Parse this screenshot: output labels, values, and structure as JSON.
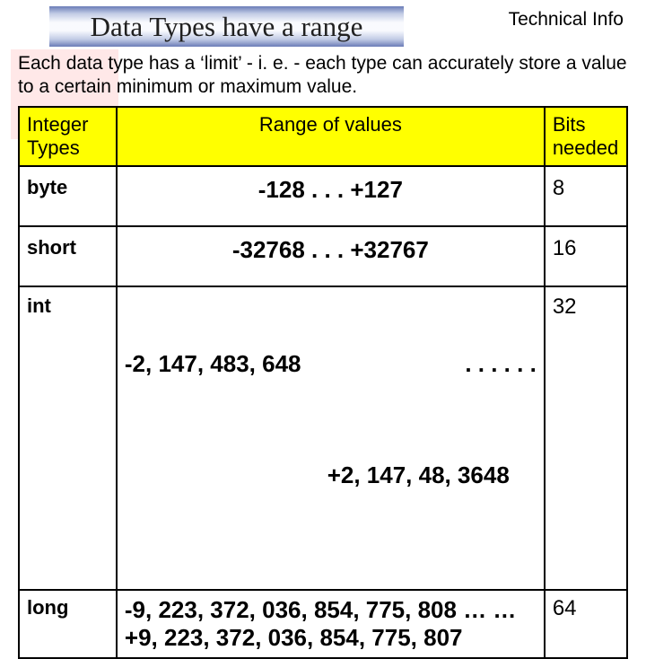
{
  "header_corner": "Technical Info",
  "title": "Data Types have a range",
  "intro": "Each data type has a ‘limit’ - i. e. - each type can accurately store a value to a certain minimum or maximum value.",
  "columns": {
    "type": "Integer Types",
    "range": "Range of values",
    "bits": "Bits needed"
  },
  "rows": [
    {
      "type": "byte",
      "range": "-128 . . . +127",
      "bits": "8"
    },
    {
      "type": "short",
      "range": "-32768 . . . +32767",
      "bits": "16"
    },
    {
      "type": "int",
      "range_lo": "-2, 147, 483, 648",
      "range_dots": ". . . . . .",
      "range_hi": "+2, 147, 48, 3648",
      "bits": "32"
    },
    {
      "type": "long",
      "range": "-9, 223, 372, 036, 854, 775, 808 … …+9, 223, 372, 036, 854, 775, 807",
      "bits": "64"
    }
  ]
}
